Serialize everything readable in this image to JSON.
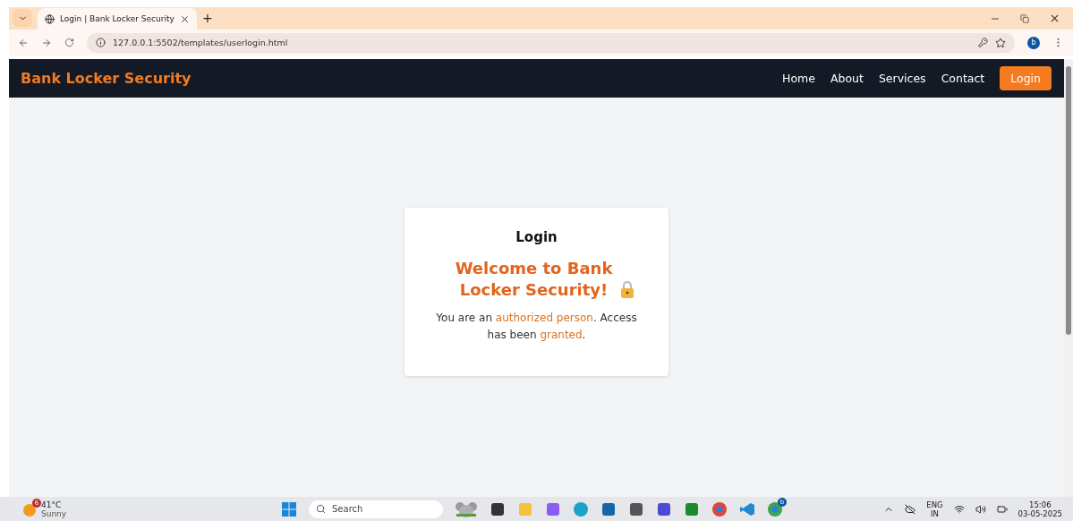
{
  "browser": {
    "tab": {
      "title": "Login | Bank Locker Security",
      "selected": true
    },
    "new_tab": "+",
    "url": "127.0.0.1:5502/templates/userlogin.html",
    "profile": "b"
  },
  "navbar": {
    "brand": "Bank Locker Security",
    "links": [
      {
        "label": "Home"
      },
      {
        "label": "About"
      },
      {
        "label": "Services"
      },
      {
        "label": "Contact"
      }
    ],
    "login_button": "Login"
  },
  "card": {
    "title": "Login",
    "heading": "Welcome to Bank Locker Security!",
    "message": [
      {
        "text": "You are an ",
        "highlight": false
      },
      {
        "text": "authorized person",
        "highlight": true
      },
      {
        "text": ". Access has been ",
        "highlight": false
      },
      {
        "text": "granted",
        "highlight": true
      },
      {
        "text": ".",
        "highlight": false
      }
    ]
  },
  "taskbar": {
    "weather": {
      "badge": "6",
      "temperature": "41°C",
      "condition": "Sunny"
    },
    "search": {
      "placeholder": "Search"
    },
    "language": "ENG",
    "region": "IN",
    "time": "15:06",
    "date": "03-05-2025",
    "chrome_badge": "b"
  }
}
